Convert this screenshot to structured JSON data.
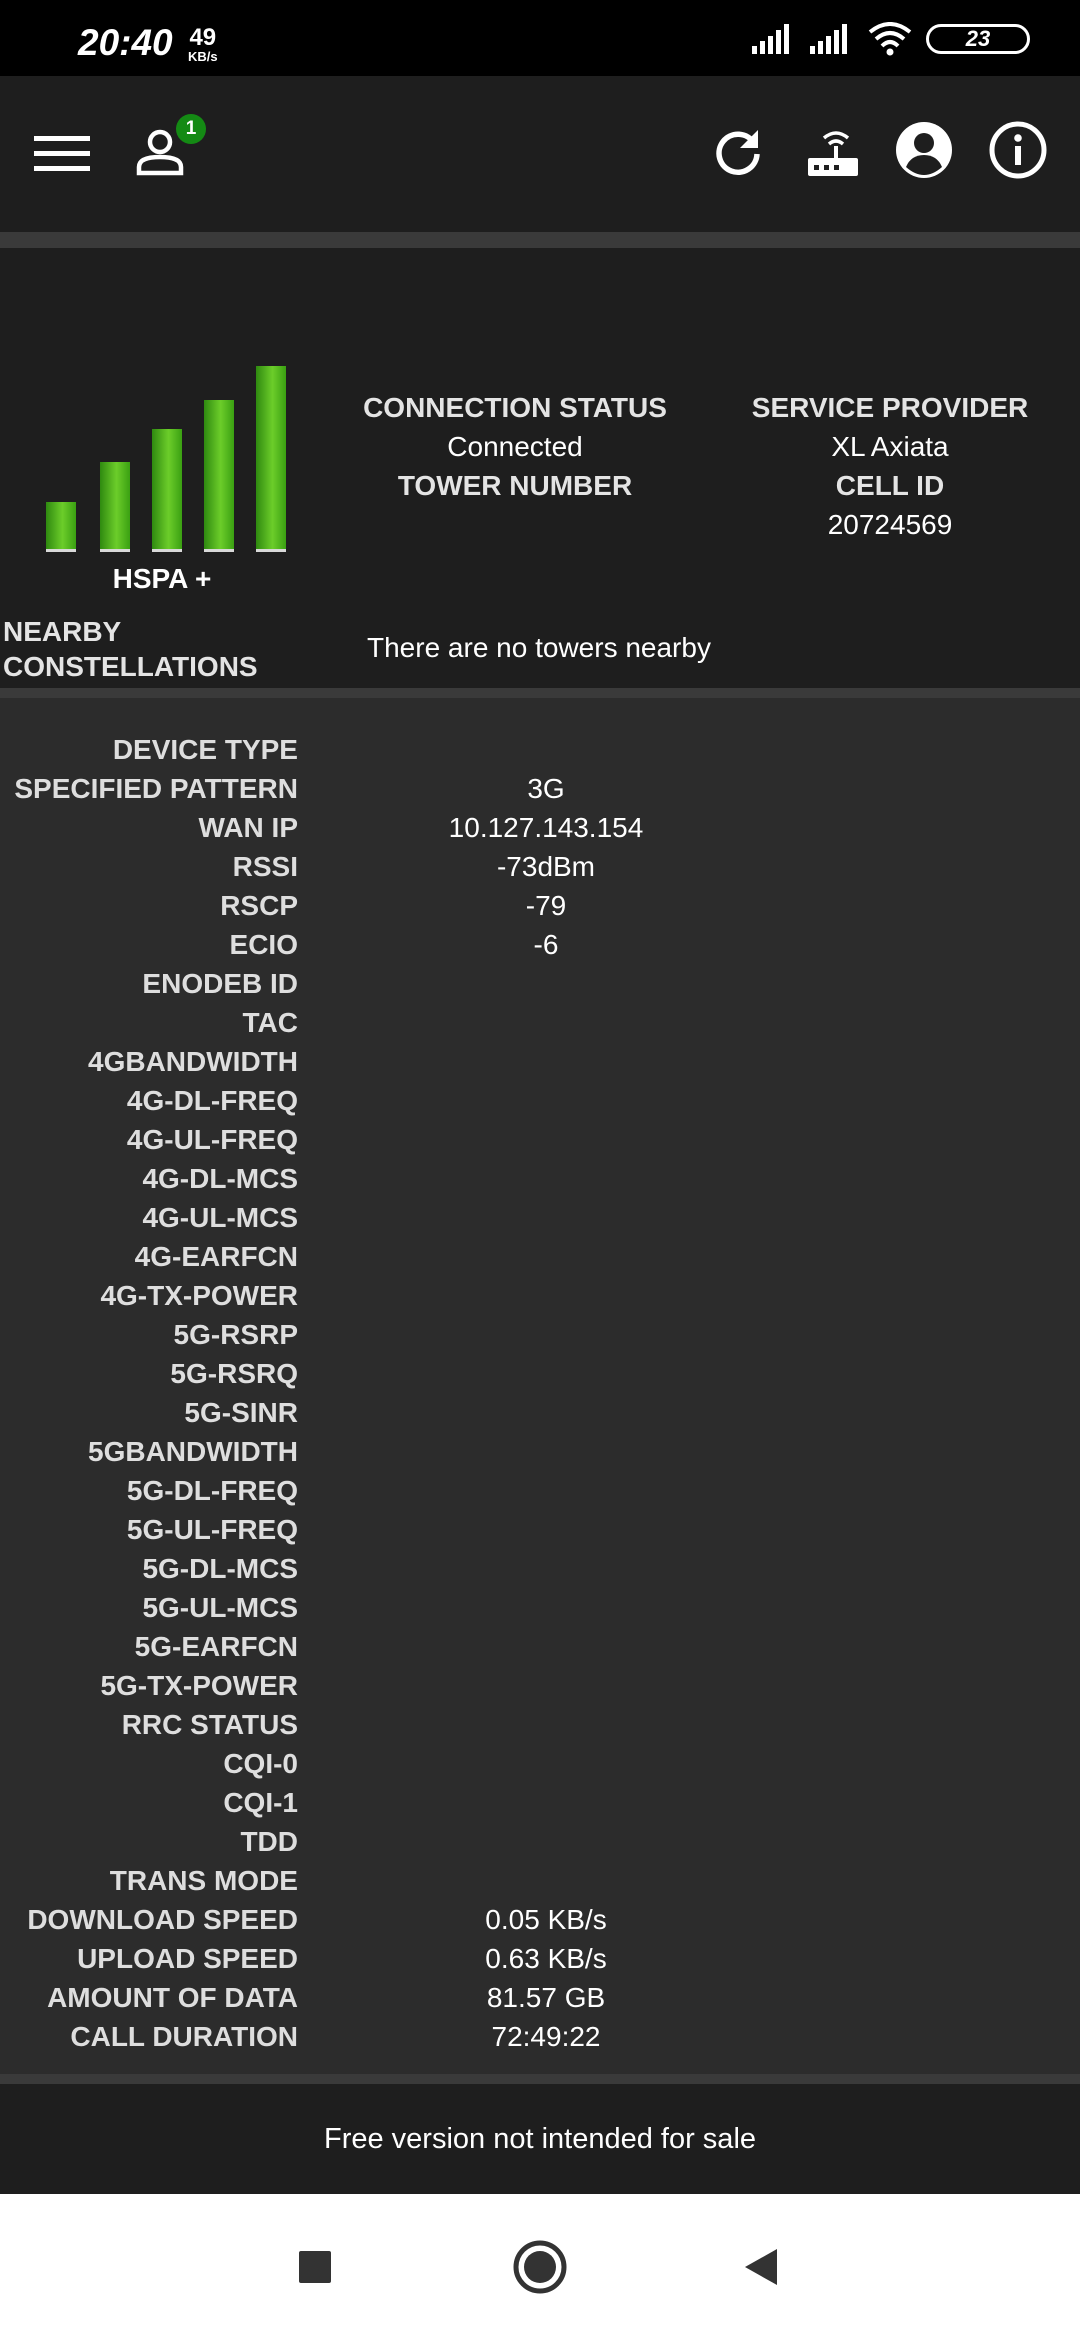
{
  "status_bar": {
    "time": "20:40",
    "speed_value": "49",
    "speed_unit": "KB/s",
    "battery": "23",
    "icons": [
      "signal-sim1-icon",
      "signal-sim2-icon",
      "wifi-icon",
      "battery-icon"
    ]
  },
  "toolbar": {
    "notification_count": "1",
    "icons": [
      "menu-icon",
      "account-icon",
      "refresh-icon",
      "router-icon",
      "profile-icon",
      "info-icon"
    ]
  },
  "summary": {
    "network_type": "HSPA +",
    "signal_bars_active": 5,
    "signal_bars_total": 5,
    "connection_status_label": "CONNECTION STATUS",
    "connection_status_value": "Connected",
    "tower_number_label": "TOWER NUMBER",
    "tower_number_value": "",
    "service_provider_label": "SERVICE PROVIDER",
    "service_provider_value": "XL Axiata",
    "cell_id_label": "CELL ID",
    "cell_id_value": "20724569",
    "nearby_label_line1": "NEARBY",
    "nearby_label_line2": "CONSTELLATIONS",
    "nearby_text": "There are no towers nearby"
  },
  "details": [
    {
      "label": "DEVICE TYPE",
      "value": ""
    },
    {
      "label": "SPECIFIED PATTERN",
      "value": "3G"
    },
    {
      "label": "WAN IP",
      "value": "10.127.143.154"
    },
    {
      "label": "RSSI",
      "value": "-73dBm"
    },
    {
      "label": "RSCP",
      "value": "-79"
    },
    {
      "label": "ECIO",
      "value": "-6"
    },
    {
      "label": "ENODEB ID",
      "value": ""
    },
    {
      "label": "TAC",
      "value": ""
    },
    {
      "label": "4GBANDWIDTH",
      "value": ""
    },
    {
      "label": "4G-DL-FREQ",
      "value": ""
    },
    {
      "label": "4G-UL-FREQ",
      "value": ""
    },
    {
      "label": "4G-DL-MCS",
      "value": ""
    },
    {
      "label": "4G-UL-MCS",
      "value": ""
    },
    {
      "label": "4G-EARFCN",
      "value": ""
    },
    {
      "label": "4G-TX-POWER",
      "value": ""
    },
    {
      "label": "5G-RSRP",
      "value": ""
    },
    {
      "label": "5G-RSRQ",
      "value": ""
    },
    {
      "label": "5G-SINR",
      "value": ""
    },
    {
      "label": "5GBANDWIDTH",
      "value": ""
    },
    {
      "label": "5G-DL-FREQ",
      "value": ""
    },
    {
      "label": "5G-UL-FREQ",
      "value": ""
    },
    {
      "label": "5G-DL-MCS",
      "value": ""
    },
    {
      "label": "5G-UL-MCS",
      "value": ""
    },
    {
      "label": "5G-EARFCN",
      "value": ""
    },
    {
      "label": "5G-TX-POWER",
      "value": ""
    },
    {
      "label": "RRC STATUS",
      "value": ""
    },
    {
      "label": "CQI-0",
      "value": ""
    },
    {
      "label": "CQI-1",
      "value": ""
    },
    {
      "label": "TDD",
      "value": ""
    },
    {
      "label": "TRANS MODE",
      "value": ""
    },
    {
      "label": "DOWNLOAD SPEED",
      "value": "0.05 KB/s"
    },
    {
      "label": "UPLOAD SPEED",
      "value": "0.63 KB/s"
    },
    {
      "label": "AMOUNT OF DATA",
      "value": "81.57 GB"
    },
    {
      "label": "CALL DURATION",
      "value": "72:49:22"
    }
  ],
  "footer": {
    "text": "Free version not intended for sale"
  },
  "navbar": {
    "icons": [
      "recents-icon",
      "home-icon",
      "back-icon"
    ]
  }
}
